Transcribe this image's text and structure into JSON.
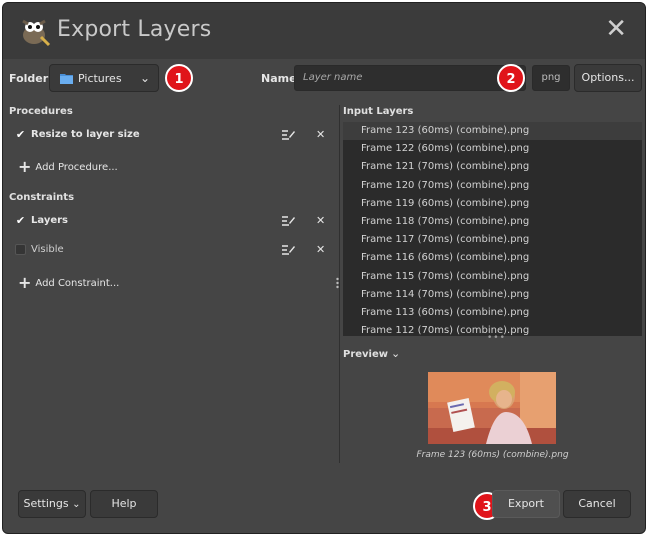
{
  "window": {
    "title": "Export Layers"
  },
  "toolbar": {
    "folder_label": "Folder:",
    "folder_value": "Pictures",
    "name_label": "Name:",
    "name_placeholder": "Layer name",
    "extension": "png",
    "options_label": "Options..."
  },
  "markers": {
    "m1": "1",
    "m2": "2",
    "m3": "3"
  },
  "procedures": {
    "heading": "Procedures",
    "items": [
      {
        "label": "Resize to layer size",
        "checked": true
      }
    ],
    "add_label": "Add Procedure..."
  },
  "constraints": {
    "heading": "Constraints",
    "items": [
      {
        "label": "Layers",
        "checked": true
      },
      {
        "label": "Visible",
        "checked": false
      }
    ],
    "add_label": "Add Constraint..."
  },
  "input_layers": {
    "heading": "Input Layers",
    "items": [
      "Frame 123 (60ms) (combine).png",
      "Frame 122 (60ms) (combine).png",
      "Frame 121 (70ms) (combine).png",
      "Frame 120 (70ms) (combine).png",
      "Frame 119 (60ms) (combine).png",
      "Frame 118 (70ms) (combine).png",
      "Frame 117 (70ms) (combine).png",
      "Frame 116 (60ms) (combine).png",
      "Frame 115 (70ms) (combine).png",
      "Frame 114 (70ms) (combine).png",
      "Frame 113 (60ms) (combine).png",
      "Frame 112 (70ms) (combine).png"
    ]
  },
  "preview": {
    "label": "Preview",
    "caption": "Frame 123 (60ms) (combine).png"
  },
  "footer": {
    "settings_label": "Settings",
    "help_label": "Help",
    "export_label": "Export",
    "cancel_label": "Cancel"
  },
  "icons": {
    "app": "gimp-wilber-icon",
    "close": "close-icon",
    "folder": "folder-icon",
    "edit": "edit-icon",
    "remove": "remove-icon",
    "add": "plus-icon",
    "chevron": "chevron-down-icon"
  },
  "colors": {
    "window_bg": "#454545",
    "title_bg": "#3b3b3b",
    "list_bg": "#2b2b2b",
    "marker_red": "#e0141a"
  }
}
